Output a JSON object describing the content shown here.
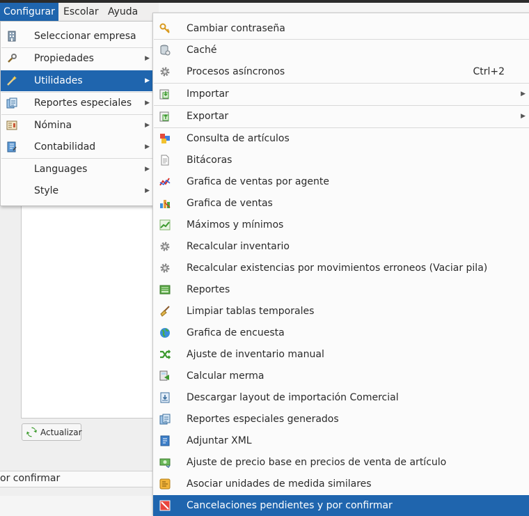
{
  "menubar": {
    "items": [
      "Configurar",
      "Escolar",
      "Ayuda"
    ]
  },
  "config_menu": {
    "items": [
      {
        "label": "Seleccionar empresa",
        "icon": "building-icon",
        "submenu": false
      },
      {
        "label": "Propiedades",
        "icon": "wrench-icon",
        "submenu": true
      },
      {
        "label": "Utilidades",
        "icon": "magic-wand-icon",
        "submenu": true
      },
      {
        "label": "Reportes especiales",
        "icon": "report-stack-icon",
        "submenu": true
      },
      {
        "label": "Nómina",
        "icon": "payroll-icon",
        "submenu": true
      },
      {
        "label": "Contabilidad",
        "icon": "ledger-icon",
        "submenu": true
      },
      {
        "label": "Languages",
        "icon": "",
        "submenu": true
      },
      {
        "label": "Style",
        "icon": "",
        "submenu": true
      }
    ]
  },
  "utilidades_menu": {
    "items": [
      {
        "label": "Cambiar contraseña",
        "icon": "key-icon"
      },
      {
        "label": "Caché",
        "icon": "database-icon"
      },
      {
        "label": "Procesos asíncronos",
        "icon": "gear-icon",
        "shortcut": "Ctrl+2"
      },
      {
        "label": "Importar",
        "icon": "import-icon",
        "submenu": true
      },
      {
        "label": "Exportar",
        "icon": "export-icon",
        "submenu": true
      },
      {
        "label": "Consulta de artículos",
        "icon": "items-icon"
      },
      {
        "label": "Bitácoras",
        "icon": "log-document-icon"
      },
      {
        "label": "Grafica de ventas por agente",
        "icon": "line-graph-icon"
      },
      {
        "label": "Grafica de ventas",
        "icon": "bar-graph-icon"
      },
      {
        "label": "Máximos y mínimos",
        "icon": "trend-chart-icon"
      },
      {
        "label": "Recalcular inventario",
        "icon": "gear-icon"
      },
      {
        "label": "Recalcular existencias por movimientos erroneos (Vaciar pila)",
        "icon": "gear-icon"
      },
      {
        "label": "Reportes",
        "icon": "report-icon"
      },
      {
        "label": "Limpiar tablas temporales",
        "icon": "broom-icon"
      },
      {
        "label": "Grafica de encuesta",
        "icon": "globe-icon"
      },
      {
        "label": "Ajuste de inventario manual",
        "icon": "shuffle-icon"
      },
      {
        "label": "Calcular merma",
        "icon": "calculator-icon"
      },
      {
        "label": "Descargar layout de importación Comercial",
        "icon": "download-layout-icon"
      },
      {
        "label": "Reportes especiales generados",
        "icon": "report-stack-icon"
      },
      {
        "label": "Adjuntar XML",
        "icon": "xml-attach-icon"
      },
      {
        "label": "Ajuste de precio base en precios de venta de artículo",
        "icon": "price-tag-icon"
      },
      {
        "label": "Asociar unidades de medida similares",
        "icon": "units-icon"
      },
      {
        "label": "Cancelaciones pendientes y por confirmar",
        "icon": "cancel-icon"
      }
    ]
  },
  "app": {
    "refresh_button": "Actualizar",
    "status_text": "or confirmar"
  },
  "colors": {
    "highlight": "#1f65ae",
    "menu_bg": "#fbfbfb"
  }
}
